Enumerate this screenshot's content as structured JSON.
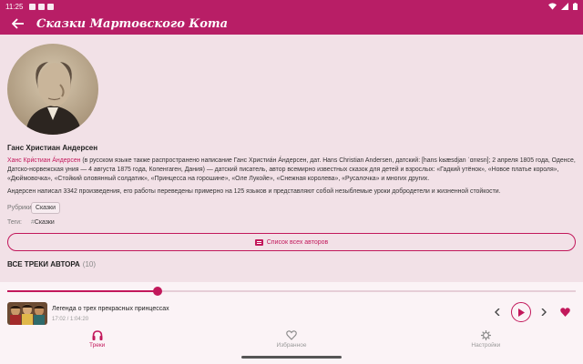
{
  "status_bar": {
    "time": "11:25"
  },
  "app_bar": {
    "title": "Сказки Мартовского Кота"
  },
  "author": {
    "name": "Ганс Христиан Андерсен",
    "bio_highlight": "Ханс Кри́стиан А́ндерсен",
    "bio_rest": " (в русском языке также распространено написание Ганс Христиа́н А́ндерсен, дат. Hans Christian Andersen, датский: [hans kʁæsdjan ˈɑnɐsn]; 2 апреля 1805 года, Оденсе, Датско-норвежская уния — 4 августа 1875 года, Копенгаген, Дания) — датский писатель, автор всемирно известных сказок для детей и взрослых: «Гадкий утёнок», «Новое платье короля», «Дюймовочка», «Стойкий оловянный солдатик», «Принцесса на горошине», «Оле Лукойе», «Снежная королева», «Русалочка» и многих других.",
    "bio_second": "Андерсен написал 3342 произведения, его работы переведены примерно на 125 языков и представляют собой незыблемые уроки добродетели и жизненной стойкости.",
    "rubrics_label": "Рубрики:",
    "rubric": "Сказки",
    "tags_label": "Теги:",
    "tag_hash": "#",
    "tag": "Сказки"
  },
  "authors_list_button": "Список всех авторов",
  "tracks_section": {
    "title": "ВСЕ ТРЕКИ АВТОРА",
    "count": "(10)"
  },
  "player": {
    "track_title": "Легенда о трех прекрасных принцессах",
    "time": "17:02 / 1:04:20",
    "progress": 0.265
  },
  "bottom_nav": [
    {
      "label": "Треки",
      "icon": "headphones-icon",
      "active": true
    },
    {
      "label": "Избранное",
      "icon": "heart-outline-icon",
      "active": false
    },
    {
      "label": "Настройки",
      "icon": "gear-icon",
      "active": false
    }
  ],
  "colors": {
    "accent": "#b81e66",
    "background": "#f2e1e7"
  }
}
